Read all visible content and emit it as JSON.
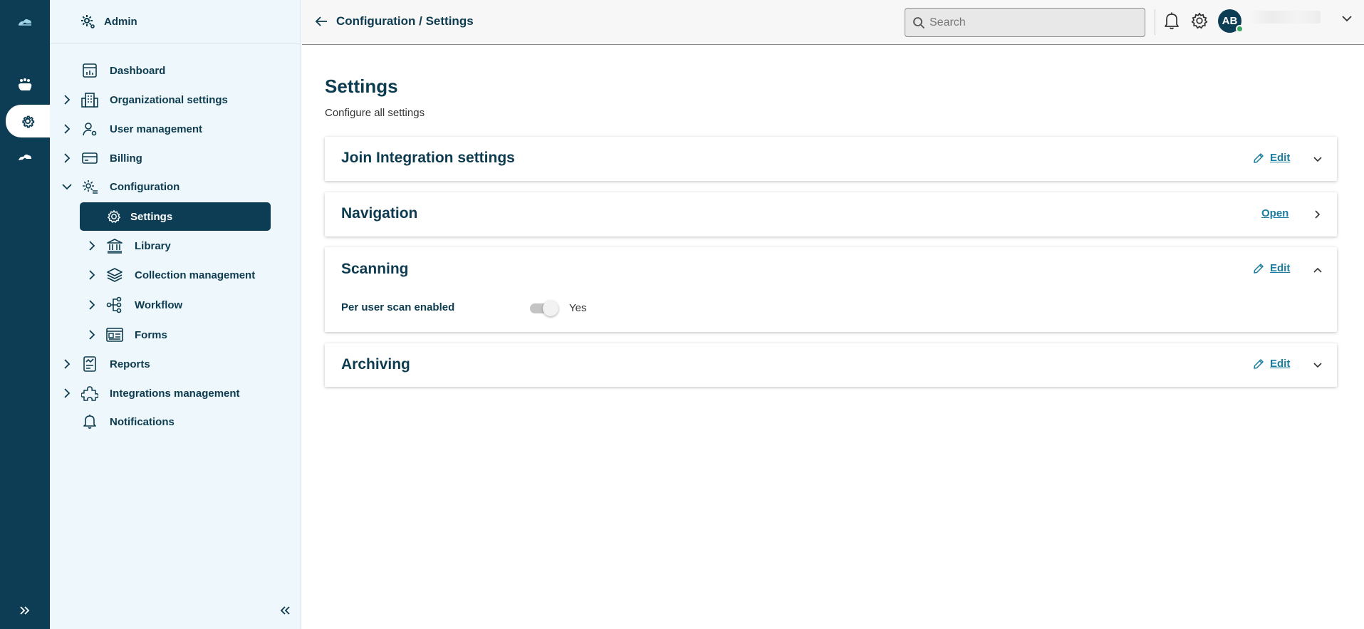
{
  "rail": {
    "items": [
      {
        "icon": "hands-icon"
      },
      {
        "icon": "gear-icon",
        "active": true
      },
      {
        "icon": "cloud-icon"
      }
    ],
    "expand_icon": "double-chevron-right-icon"
  },
  "sidebar": {
    "header": "Admin",
    "items": [
      {
        "label": "Dashboard",
        "icon": "dashboard-icon"
      },
      {
        "label": "Organizational settings",
        "icon": "building-icon",
        "expandable": true
      },
      {
        "label": "User management",
        "icon": "user-gear-icon",
        "expandable": true
      },
      {
        "label": "Billing",
        "icon": "card-icon",
        "expandable": true
      },
      {
        "label": "Configuration",
        "icon": "config-icon",
        "expanded": true
      },
      {
        "label": "Settings",
        "icon": "gear-icon",
        "selected": true
      },
      {
        "label": "Library",
        "icon": "bank-icon",
        "expandable": true
      },
      {
        "label": "Collection management",
        "icon": "layers-icon",
        "expandable": true
      },
      {
        "label": "Workflow",
        "icon": "workflow-icon",
        "expandable": true
      },
      {
        "label": "Forms",
        "icon": "form-icon",
        "expandable": true
      },
      {
        "label": "Reports",
        "icon": "report-icon",
        "expandable": true
      },
      {
        "label": "Integrations management",
        "icon": "puzzle-icon",
        "expandable": true
      },
      {
        "label": "Notifications",
        "icon": "bell-icon"
      }
    ],
    "collapse_icon": "double-chevron-left-icon"
  },
  "topbar": {
    "breadcrumb": "Configuration / Settings",
    "search_placeholder": "Search",
    "avatar_initials": "AB"
  },
  "main": {
    "title": "Settings",
    "subtitle": "Configure all settings",
    "cards": [
      {
        "title": "Join Integration settings",
        "action": "Edit",
        "state": "collapsed"
      },
      {
        "title": "Navigation",
        "action": "Open",
        "state": "link"
      },
      {
        "title": "Scanning",
        "action": "Edit",
        "state": "expanded",
        "fields": [
          {
            "label": "Per user scan enabled",
            "value": "Yes",
            "toggle_on": true
          }
        ]
      },
      {
        "title": "Archiving",
        "action": "Edit",
        "state": "collapsed"
      }
    ]
  },
  "colors": {
    "primary": "#0c3d55",
    "link": "#1a7d9e",
    "sidebar_bg": "#eef7fb"
  }
}
